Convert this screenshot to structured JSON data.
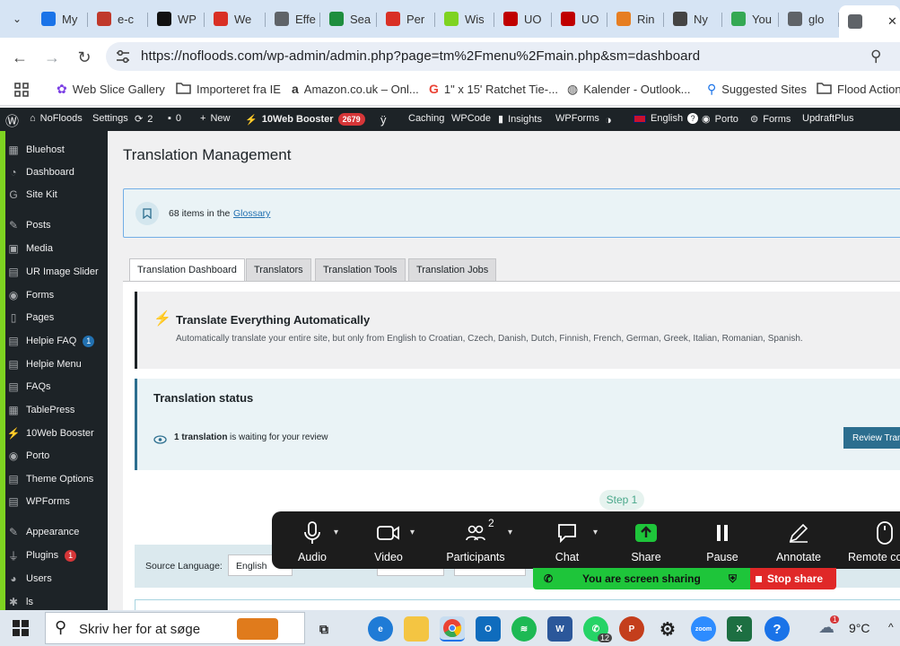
{
  "browser": {
    "tabs": [
      {
        "label": "My",
        "icon": "grid-app-icon",
        "color": "#1a73e8"
      },
      {
        "label": "e-c",
        "icon": "red-swoosh-icon",
        "color": "#c0392b"
      },
      {
        "label": "WP",
        "icon": "openai-icon",
        "color": "#111111"
      },
      {
        "label": "We",
        "icon": "gmail-icon",
        "color": "#d93025"
      },
      {
        "label": "Effe",
        "icon": "tag-icon",
        "color": "#5f6368"
      },
      {
        "label": "Sea",
        "icon": "green-plus-icon",
        "color": "#1e8e3e"
      },
      {
        "label": "Per",
        "icon": "gmail-icon",
        "color": "#d93025"
      },
      {
        "label": "Wis",
        "icon": "wise-icon",
        "color": "#7ed321"
      },
      {
        "label": "UO",
        "icon": "red-bars-icon",
        "color": "#c00000"
      },
      {
        "label": "UO",
        "icon": "red-bars-icon",
        "color": "#c00000"
      },
      {
        "label": "Rin",
        "icon": "candle-icon",
        "color": "#e67e22"
      },
      {
        "label": "Ny",
        "icon": "chrome-icon",
        "color": "#444444"
      },
      {
        "label": "You",
        "icon": "triangle-icon",
        "color": "#34a853"
      },
      {
        "label": "glo",
        "icon": "search-g-icon",
        "color": "#5f6368"
      },
      {
        "label": "",
        "icon": "globe-icon",
        "color": "#5f6368",
        "active": true
      }
    ],
    "close_symbol": "✕",
    "url": "https://nofloods.com/wp-admin/admin.php?page=tm%2Fmenu%2Fmain.php&sm=dashboard"
  },
  "bookmarks": [
    {
      "label": "Web Slice Gallery",
      "icon": "web-slice-icon"
    },
    {
      "label": "Importeret fra IE",
      "icon": "folder-icon"
    },
    {
      "label": "Amazon.co.uk – Onl...",
      "icon": "amazon-icon"
    },
    {
      "label": "1\" x 15' Ratchet Tie-...",
      "icon": "google-icon"
    },
    {
      "label": "Kalender - Outlook...",
      "icon": "globe-icon"
    },
    {
      "label": "Suggested Sites",
      "icon": "bookmark-search-icon"
    },
    {
      "label": "Flood Action",
      "icon": "folder-icon"
    }
  ],
  "wp_admin_bar": {
    "site": "NoFloods",
    "settings": "Settings",
    "updates": "2",
    "comments": "0",
    "new": "New",
    "booster": "10Web Booster",
    "booster_count": "2679",
    "caching": "Caching",
    "wpcode": "WPCode",
    "insights": "Insights",
    "wpforms": "WPForms",
    "language": "English",
    "porto": "Porto",
    "forms": "Forms",
    "updraft": "UpdraftPlus"
  },
  "sidebar": {
    "items": [
      {
        "label": "Bluehost",
        "icon": "grid-icon"
      },
      {
        "label": "Dashboard",
        "icon": "dashboard-icon"
      },
      {
        "label": "Site Kit",
        "icon": "google-g-icon"
      },
      {
        "label": "Posts",
        "icon": "pin-icon"
      },
      {
        "label": "Media",
        "icon": "media-icon"
      },
      {
        "label": "UR Image Slider",
        "icon": "slider-icon"
      },
      {
        "label": "Forms",
        "icon": "forms-icon"
      },
      {
        "label": "Pages",
        "icon": "pages-icon"
      },
      {
        "label": "Helpie FAQ",
        "icon": "faq-icon",
        "badge": "1"
      },
      {
        "label": "Helpie Menu",
        "icon": "menu-icon"
      },
      {
        "label": "FAQs",
        "icon": "faqs-icon"
      },
      {
        "label": "TablePress",
        "icon": "table-icon"
      },
      {
        "label": "10Web Booster",
        "icon": "booster-icon"
      },
      {
        "label": "Porto",
        "icon": "porto-icon"
      },
      {
        "label": "Theme Options",
        "icon": "gear-icon"
      },
      {
        "label": "WPForms",
        "icon": "wpforms-icon"
      },
      {
        "label": "Appearance",
        "icon": "brush-icon"
      },
      {
        "label": "Plugins",
        "icon": "plug-icon",
        "badge": "1"
      },
      {
        "label": "Users",
        "icon": "user-icon"
      },
      {
        "label": "ls",
        "icon": "wrench-icon"
      }
    ]
  },
  "main": {
    "title": "Translation Management",
    "glossary_count": "68 items in the",
    "glossary_link": "Glossary",
    "tabs": [
      "Translation Dashboard",
      "Translators",
      "Translation Tools",
      "Translation Jobs"
    ],
    "auto_title": "Translate Everything Automatically",
    "auto_desc": "Automatically translate your entire site, but only from English to Croatian, Czech, Danish, Dutch, Finnish, French, German, Greek, Italian, Romanian, Spanish.",
    "status_title": "Translation status",
    "status_count": "1 translation",
    "status_rest": "is waiting for your review",
    "review_button": "Review Translations",
    "step": "Step 1",
    "source_label": "Source Language:",
    "source_value": "English"
  },
  "zoom": {
    "audio": "Audio",
    "video": "Video",
    "participants": "Participants",
    "participants_count": "2",
    "chat": "Chat",
    "share": "Share",
    "pause": "Pause",
    "annotate": "Annotate",
    "remote": "Remote co",
    "sharing_text": "You are screen sharing",
    "stop_share": "Stop share",
    "accent_green": "#1ec53a",
    "stop_red": "#e02828"
  },
  "taskbar": {
    "search_placeholder": "Skriv her for at søge",
    "temperature": "9°C",
    "whatsapp_badge": "12",
    "weather_badge": "1"
  }
}
